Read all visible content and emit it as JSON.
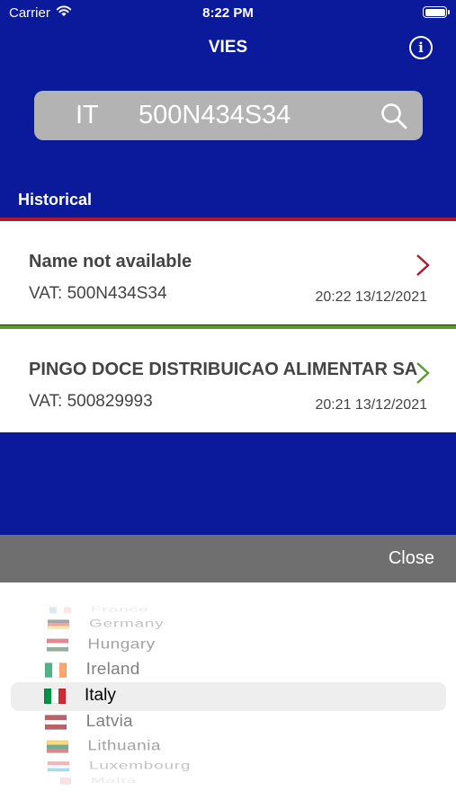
{
  "status": {
    "carrier": "Carrier",
    "time": "8:22 PM"
  },
  "nav": {
    "title": "VIES"
  },
  "search": {
    "country": "IT",
    "vat": "500N434S34"
  },
  "history": {
    "label": "Historical",
    "items": [
      {
        "name": "Name not available",
        "vat": "VAT: 500N434S34",
        "date": "20:22 13/12/2021",
        "accent": "#b3172a"
      },
      {
        "name": "PINGO DOCE DISTRIBUICAO ALIMENTAR SA",
        "vat": "VAT: 500829993",
        "date": "20:21 13/12/2021",
        "accent": "#5b9a2e"
      }
    ]
  },
  "toolbar": {
    "close_label": "Close"
  },
  "picker": {
    "selected": "Italy",
    "options": [
      {
        "label": "France",
        "flag_colors": [
          "#0055A4",
          "#FFFFFF",
          "#EF4135"
        ],
        "flag_dir": "v"
      },
      {
        "label": "Germany",
        "flag_colors": [
          "#000000",
          "#DD0000",
          "#FFCE00"
        ],
        "flag_dir": "h"
      },
      {
        "label": "Hungary",
        "flag_colors": [
          "#CD2A3E",
          "#FFFFFF",
          "#436F4D"
        ],
        "flag_dir": "h"
      },
      {
        "label": "Ireland",
        "flag_colors": [
          "#169B62",
          "#FFFFFF",
          "#FF883E"
        ],
        "flag_dir": "v"
      },
      {
        "label": "Italy",
        "flag_colors": [
          "#009246",
          "#FFFFFF",
          "#CE2B37"
        ],
        "flag_dir": "v"
      },
      {
        "label": "Latvia",
        "flag_colors": [
          "#9E3039",
          "#FFFFFF",
          "#9E3039"
        ],
        "flag_dir": "h"
      },
      {
        "label": "Lithuania",
        "flag_colors": [
          "#FDB913",
          "#006A44",
          "#C1272D"
        ],
        "flag_dir": "h"
      },
      {
        "label": "Luxembourg",
        "flag_colors": [
          "#ED2939",
          "#FFFFFF",
          "#00A1DE"
        ],
        "flag_dir": "h"
      },
      {
        "label": "Malta",
        "flag_colors": [
          "#FFFFFF",
          "#CF142B"
        ],
        "flag_dir": "v"
      }
    ]
  }
}
